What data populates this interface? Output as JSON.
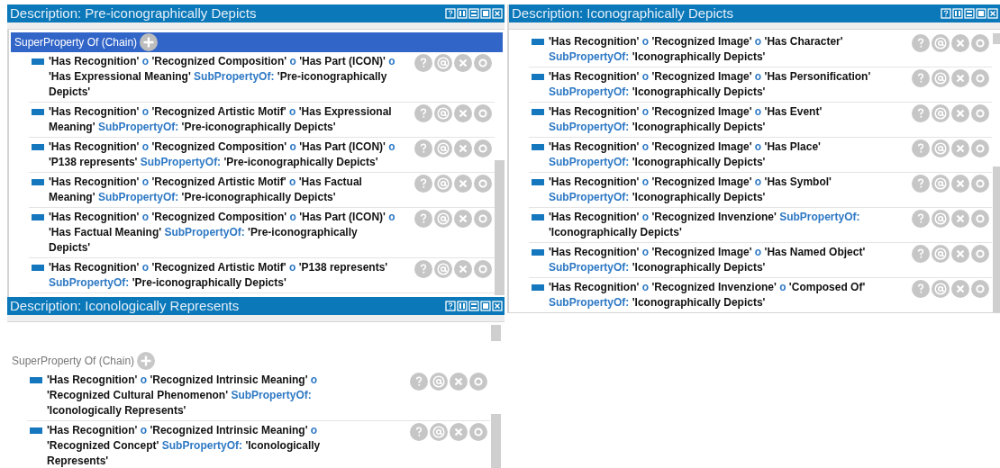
{
  "panels": [
    {
      "title": "Description: Pre-iconographically Depicts",
      "section": {
        "label": "SuperProperty Of (Chain)",
        "selected": true
      },
      "rows": [
        {
          "axiom": [
            {
              "kind": "entity",
              "text": "'Has Recognition'"
            },
            {
              "kind": "keyword",
              "text": "o"
            },
            {
              "kind": "entity",
              "text": "'Recognized Composition'"
            },
            {
              "kind": "keyword",
              "text": "o"
            },
            {
              "kind": "entity",
              "text": "'Has Part (ICON)'"
            },
            {
              "kind": "keyword",
              "text": "o"
            },
            {
              "kind": "entity",
              "text": "'Has Expressional Meaning'"
            },
            {
              "kind": "keyword",
              "text": "SubPropertyOf:"
            },
            {
              "kind": "entity",
              "text": "'Pre-iconographically Depicts'"
            }
          ]
        },
        {
          "axiom": [
            {
              "kind": "entity",
              "text": "'Has Recognition'"
            },
            {
              "kind": "keyword",
              "text": "o"
            },
            {
              "kind": "entity",
              "text": "'Recognized Artistic Motif'"
            },
            {
              "kind": "keyword",
              "text": "o"
            },
            {
              "kind": "entity",
              "text": "'Has Expressional Meaning'"
            },
            {
              "kind": "keyword",
              "text": "SubPropertyOf:"
            },
            {
              "kind": "entity",
              "text": "'Pre-iconographically Depicts'"
            }
          ]
        },
        {
          "axiom": [
            {
              "kind": "entity",
              "text": "'Has Recognition'"
            },
            {
              "kind": "keyword",
              "text": "o"
            },
            {
              "kind": "entity",
              "text": "'Recognized Composition'"
            },
            {
              "kind": "keyword",
              "text": "o"
            },
            {
              "kind": "entity",
              "text": "'Has Part (ICON)'"
            },
            {
              "kind": "keyword",
              "text": "o"
            },
            {
              "kind": "entity",
              "text": "'P138 represents'"
            },
            {
              "kind": "keyword",
              "text": "SubPropertyOf:"
            },
            {
              "kind": "entity",
              "text": "'Pre-iconographically Depicts'"
            }
          ]
        },
        {
          "axiom": [
            {
              "kind": "entity",
              "text": "'Has Recognition'"
            },
            {
              "kind": "keyword",
              "text": "o"
            },
            {
              "kind": "entity",
              "text": "'Recognized Artistic Motif'"
            },
            {
              "kind": "keyword",
              "text": "o"
            },
            {
              "kind": "entity",
              "text": "'Has Factual Meaning'"
            },
            {
              "kind": "keyword",
              "text": "SubPropertyOf:"
            },
            {
              "kind": "entity",
              "text": "'Pre-iconographically Depicts'"
            }
          ]
        },
        {
          "axiom": [
            {
              "kind": "entity",
              "text": "'Has Recognition'"
            },
            {
              "kind": "keyword",
              "text": "o"
            },
            {
              "kind": "entity",
              "text": "'Recognized Composition'"
            },
            {
              "kind": "keyword",
              "text": "o"
            },
            {
              "kind": "entity",
              "text": "'Has Part (ICON)'"
            },
            {
              "kind": "keyword",
              "text": "o"
            },
            {
              "kind": "entity",
              "text": "'Has Factual Meaning'"
            },
            {
              "kind": "keyword",
              "text": "SubPropertyOf:"
            },
            {
              "kind": "entity",
              "text": "'Pre-iconographically Depicts'"
            }
          ]
        },
        {
          "axiom": [
            {
              "kind": "entity",
              "text": "'Has Recognition'"
            },
            {
              "kind": "keyword",
              "text": "o"
            },
            {
              "kind": "entity",
              "text": "'Recognized Artistic Motif'"
            },
            {
              "kind": "keyword",
              "text": "o"
            },
            {
              "kind": "entity",
              "text": "'P138 represents'"
            },
            {
              "kind": "keyword",
              "text": "SubPropertyOf:"
            },
            {
              "kind": "entity",
              "text": "'Pre-iconographically Depicts'"
            }
          ]
        }
      ]
    },
    {
      "title": "Description: Iconographically Depicts",
      "rows": [
        {
          "axiom": [
            {
              "kind": "entity",
              "text": "'Has Recognition'"
            },
            {
              "kind": "keyword",
              "text": "o"
            },
            {
              "kind": "entity",
              "text": "'Recognized Image'"
            },
            {
              "kind": "keyword",
              "text": "o"
            },
            {
              "kind": "entity",
              "text": "'Has Character'"
            },
            {
              "kind": "keyword",
              "text": "SubPropertyOf:"
            },
            {
              "kind": "entity",
              "text": "'Iconographically Depicts'"
            }
          ]
        },
        {
          "axiom": [
            {
              "kind": "entity",
              "text": "'Has Recognition'"
            },
            {
              "kind": "keyword",
              "text": "o"
            },
            {
              "kind": "entity",
              "text": "'Recognized Image'"
            },
            {
              "kind": "keyword",
              "text": "o"
            },
            {
              "kind": "entity",
              "text": "'Has Personification'"
            },
            {
              "kind": "keyword",
              "text": "SubPropertyOf:"
            },
            {
              "kind": "entity",
              "text": "'Iconographically Depicts'"
            }
          ]
        },
        {
          "axiom": [
            {
              "kind": "entity",
              "text": "'Has Recognition'"
            },
            {
              "kind": "keyword",
              "text": "o"
            },
            {
              "kind": "entity",
              "text": "'Recognized Image'"
            },
            {
              "kind": "keyword",
              "text": "o"
            },
            {
              "kind": "entity",
              "text": "'Has Event'"
            },
            {
              "kind": "keyword",
              "text": "SubPropertyOf:"
            },
            {
              "kind": "entity",
              "text": "'Iconographically Depicts'"
            }
          ]
        },
        {
          "axiom": [
            {
              "kind": "entity",
              "text": "'Has Recognition'"
            },
            {
              "kind": "keyword",
              "text": "o"
            },
            {
              "kind": "entity",
              "text": "'Recognized Image'"
            },
            {
              "kind": "keyword",
              "text": "o"
            },
            {
              "kind": "entity",
              "text": "'Has Place'"
            },
            {
              "kind": "keyword",
              "text": "SubPropertyOf:"
            },
            {
              "kind": "entity",
              "text": "'Iconographically Depicts'"
            }
          ]
        },
        {
          "axiom": [
            {
              "kind": "entity",
              "text": "'Has Recognition'"
            },
            {
              "kind": "keyword",
              "text": "o"
            },
            {
              "kind": "entity",
              "text": "'Recognized Image'"
            },
            {
              "kind": "keyword",
              "text": "o"
            },
            {
              "kind": "entity",
              "text": "'Has Symbol'"
            },
            {
              "kind": "keyword",
              "text": "SubPropertyOf:"
            },
            {
              "kind": "entity",
              "text": "'Iconographically Depicts'"
            }
          ]
        },
        {
          "axiom": [
            {
              "kind": "entity",
              "text": "'Has Recognition'"
            },
            {
              "kind": "keyword",
              "text": "o"
            },
            {
              "kind": "entity",
              "text": "'Recognized Invenzione'"
            },
            {
              "kind": "keyword",
              "text": "SubPropertyOf:"
            },
            {
              "kind": "entity",
              "text": "'Iconographically Depicts'"
            }
          ]
        },
        {
          "axiom": [
            {
              "kind": "entity",
              "text": "'Has Recognition'"
            },
            {
              "kind": "keyword",
              "text": "o"
            },
            {
              "kind": "entity",
              "text": "'Recognized Image'"
            },
            {
              "kind": "keyword",
              "text": "o"
            },
            {
              "kind": "entity",
              "text": "'Has Named Object'"
            },
            {
              "kind": "keyword",
              "text": "SubPropertyOf:"
            },
            {
              "kind": "entity",
              "text": "'Iconographically Depicts'"
            }
          ]
        },
        {
          "axiom": [
            {
              "kind": "entity",
              "text": "'Has Recognition'"
            },
            {
              "kind": "keyword",
              "text": "o"
            },
            {
              "kind": "entity",
              "text": "'Recognized Invenzione'"
            },
            {
              "kind": "keyword",
              "text": "o"
            },
            {
              "kind": "entity",
              "text": "'Composed Of'"
            },
            {
              "kind": "keyword",
              "text": "SubPropertyOf:"
            },
            {
              "kind": "entity",
              "text": "'Iconographically Depicts'"
            }
          ]
        }
      ]
    },
    {
      "title": "Description: Iconologically Represents",
      "section": {
        "label": "SuperProperty Of (Chain)",
        "selected": false
      },
      "rows": [
        {
          "axiom": [
            {
              "kind": "entity",
              "text": "'Has Recognition'"
            },
            {
              "kind": "keyword",
              "text": "o"
            },
            {
              "kind": "entity",
              "text": "'Recognized Intrinsic Meaning'"
            },
            {
              "kind": "keyword",
              "text": "o"
            },
            {
              "kind": "entity",
              "text": "'Recognized Cultural Phenomenon'"
            },
            {
              "kind": "keyword",
              "text": "SubPropertyOf:"
            },
            {
              "kind": "entity",
              "text": "'Iconologically Represents'"
            }
          ]
        },
        {
          "axiom": [
            {
              "kind": "entity",
              "text": "'Has Recognition'"
            },
            {
              "kind": "keyword",
              "text": "o"
            },
            {
              "kind": "entity",
              "text": "'Recognized Intrinsic Meaning'"
            },
            {
              "kind": "keyword",
              "text": "o"
            },
            {
              "kind": "entity",
              "text": "'Recognized Concept'"
            },
            {
              "kind": "keyword",
              "text": "SubPropertyOf:"
            },
            {
              "kind": "entity",
              "text": "'Iconologically Represents'"
            }
          ]
        }
      ]
    }
  ]
}
